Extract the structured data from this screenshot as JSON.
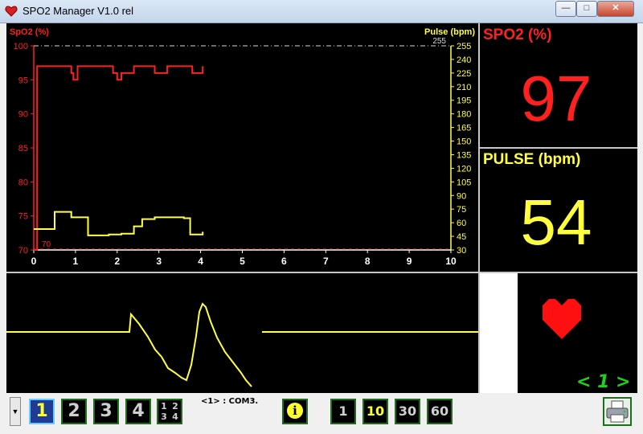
{
  "window": {
    "title": "SPO2 Manager V1.0 rel",
    "minimize": "—",
    "maximize": "□",
    "close": "✕"
  },
  "chart_data": {
    "type": "line",
    "left_axis_label": "SpO2 (%)",
    "right_axis_label": "Pulse (bpm)",
    "left_ticks": [
      "100",
      "95",
      "90",
      "85",
      "80",
      "75",
      "70"
    ],
    "right_ticks": [
      "255",
      "240",
      "225",
      "210",
      "195",
      "180",
      "165",
      "150",
      "135",
      "120",
      "105",
      "90",
      "75",
      "60",
      "45",
      "30"
    ],
    "x_ticks": [
      "0",
      "1",
      "2",
      "3",
      "4",
      "5",
      "6",
      "7",
      "8",
      "9",
      "10"
    ],
    "spo2_ylim": [
      70,
      100
    ],
    "pulse_ylim": [
      30,
      255
    ],
    "xlim": [
      0,
      10
    ],
    "spo2_low_mark": "70",
    "pulse_high_mark": "255",
    "colors": {
      "spo2": "#ff2020",
      "pulse": "#ffff40",
      "axis_left": "#ff2020",
      "axis_right": "#ffff40"
    },
    "series": [
      {
        "name": "SpO2 (%)",
        "x": [
          0.0,
          0.08,
          0.08,
          0.9,
          0.9,
          0.95,
          0.95,
          1.05,
          1.05,
          1.3,
          1.3,
          1.9,
          1.9,
          2.0,
          2.0,
          2.1,
          2.1,
          2.4,
          2.4,
          2.9,
          2.9,
          3.2,
          3.2,
          3.8,
          3.8,
          4.05,
          4.05
        ],
        "y": [
          70,
          70,
          97,
          97,
          96,
          96,
          95,
          95,
          97,
          97,
          97,
          97,
          96,
          96,
          95,
          95,
          96,
          96,
          97,
          97,
          96,
          96,
          97,
          97,
          96,
          96,
          97
        ]
      },
      {
        "name": "Pulse (bpm)",
        "x": [
          0.0,
          0.5,
          0.5,
          0.9,
          0.9,
          1.3,
          1.3,
          1.8,
          1.8,
          2.1,
          2.1,
          2.4,
          2.4,
          2.6,
          2.6,
          2.9,
          2.9,
          3.2,
          3.2,
          3.6,
          3.6,
          3.75,
          3.75,
          4.05,
          4.05
        ],
        "y": [
          53,
          53,
          72,
          72,
          66,
          66,
          46,
          46,
          47,
          47,
          48,
          48,
          56,
          56,
          64,
          64,
          66,
          66,
          66,
          66,
          65,
          65,
          47,
          47,
          50
        ]
      }
    ]
  },
  "spo2_panel": {
    "label": "SPO2 (%)",
    "value": "97"
  },
  "pulse_panel": {
    "label": "PULSE (bpm)",
    "value": "54"
  },
  "device_indicator": "< 1 >",
  "toolbar": {
    "dropdown_arrow": "▼",
    "channels": [
      "1",
      "2",
      "3",
      "4"
    ],
    "grid_button": [
      "1",
      "2",
      "3",
      "4"
    ],
    "status": "<1> : COM3.",
    "info": "i",
    "scales": [
      "1",
      "10",
      "30",
      "60"
    ]
  }
}
